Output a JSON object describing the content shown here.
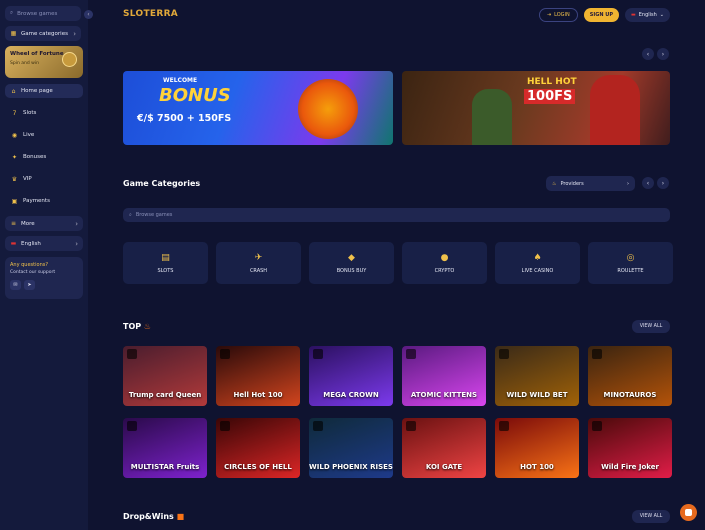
{
  "sidebar": {
    "search_placeholder": "Browse games",
    "categories_label": "Game categories",
    "wof": {
      "title": "Wheel of Fortune",
      "subtitle": "Spin and win"
    },
    "home_label": "Home page",
    "nav": [
      {
        "label": "Slots",
        "icon": "slots-icon",
        "glyph": "7"
      },
      {
        "label": "Live",
        "icon": "live-icon",
        "glyph": "◉"
      },
      {
        "label": "Bonuses",
        "icon": "bonus-icon",
        "glyph": "✦"
      },
      {
        "label": "VIP",
        "icon": "crown-icon",
        "glyph": "♛"
      },
      {
        "label": "Payments",
        "icon": "wallet-icon",
        "glyph": "▣"
      }
    ],
    "more_label": "More",
    "lang_label": "English",
    "questions": {
      "title": "Any questions?",
      "subtitle": "Contact our support"
    }
  },
  "header": {
    "logo": "SLOTERRA",
    "login": "LOGIN",
    "signup": "SIGN UP",
    "lang": "English"
  },
  "banners": {
    "welcome": "WELCOME",
    "bonus": "BONUS",
    "amount": "€/$ 7500 + 150FS",
    "hellhot": "HELL HOT",
    "fs": "100FS"
  },
  "categories": {
    "title": "Game Categories",
    "providers_label": "Providers",
    "search_placeholder": "Browse games",
    "items": [
      {
        "label": "SLOTS",
        "glyph": "▤"
      },
      {
        "label": "CRASH",
        "glyph": "✈"
      },
      {
        "label": "BONUS BUY",
        "glyph": "◆"
      },
      {
        "label": "CRYPTO",
        "glyph": "●"
      },
      {
        "label": "LIVE CASINO",
        "glyph": "♠"
      },
      {
        "label": "ROULETTE",
        "glyph": "◎"
      }
    ]
  },
  "top": {
    "title": "TOP",
    "view_all": "VIEW ALL",
    "row1": [
      {
        "title": "Trump card Queen",
        "color1": "#4a1d2e",
        "color2": "#b33a3a"
      },
      {
        "title": "Hell Hot 100",
        "color1": "#2a0a0a",
        "color2": "#d2451e"
      },
      {
        "title": "MEGA CROWN",
        "color1": "#2b1060",
        "color2": "#7c3aed"
      },
      {
        "title": "ATOMIC KITTENS",
        "color1": "#5a1a80",
        "color2": "#d946ef"
      },
      {
        "title": "WILD WILD BET",
        "color1": "#3a2a18",
        "color2": "#a16207"
      },
      {
        "title": "MINOTAUROS",
        "color1": "#3a2410",
        "color2": "#b45309"
      }
    ],
    "row2": [
      {
        "title": "MULTISTAR Fruits",
        "color1": "#2a0a4a",
        "color2": "#7e22ce"
      },
      {
        "title": "CIRCLES OF HELL",
        "color1": "#3a0606",
        "color2": "#dc2626"
      },
      {
        "title": "WILD PHOENIX RISES",
        "color1": "#0f2a3a",
        "color2": "#1e3a8a"
      },
      {
        "title": "KOI GATE",
        "color1": "#6b1111",
        "color2": "#ef4444"
      },
      {
        "title": "HOT 100",
        "color1": "#7a0a0a",
        "color2": "#f97316"
      },
      {
        "title": "Wild Fire Joker",
        "color1": "#4a0a0a",
        "color2": "#e11d48"
      }
    ]
  },
  "drops": {
    "title": "Drop&Wins",
    "view_all": "VIEW ALL"
  }
}
